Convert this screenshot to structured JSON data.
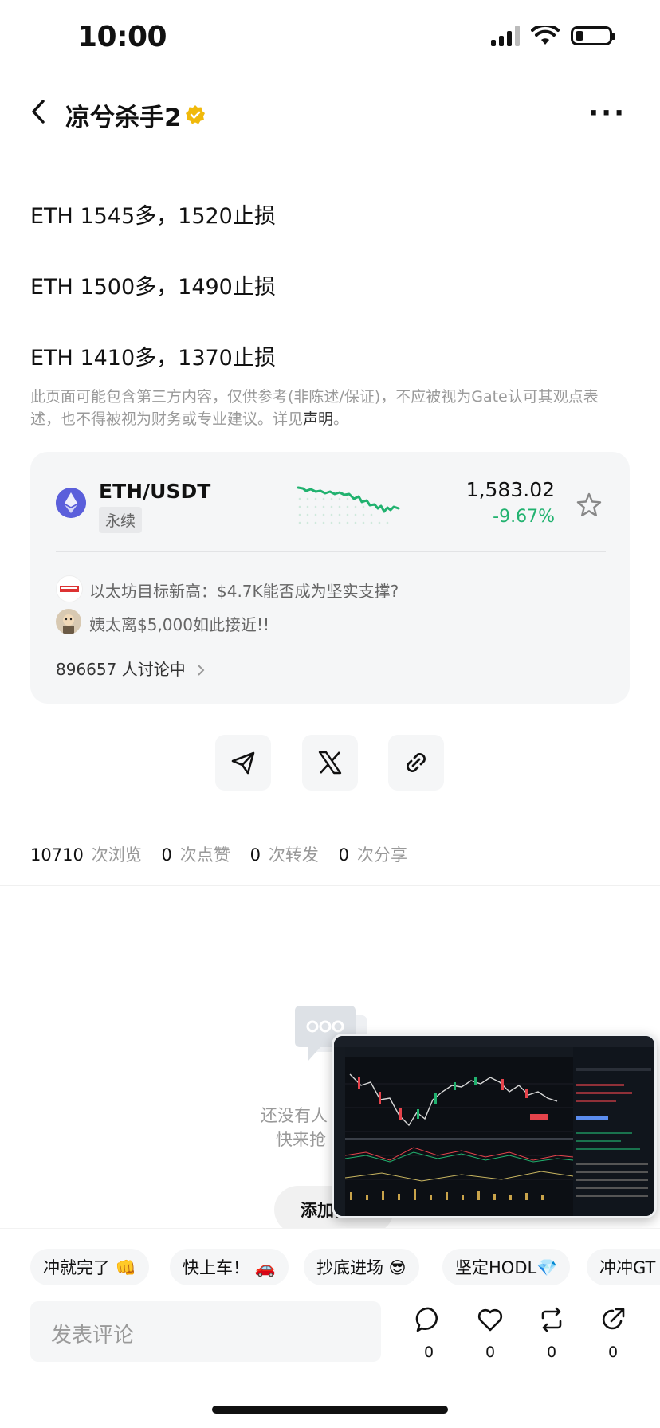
{
  "status_bar": {
    "time": "10:00"
  },
  "header": {
    "author": "凉兮杀手2"
  },
  "post": {
    "lines": [
      "ETH 1545多，1520止损",
      "ETH 1500多，1490止损",
      "ETH 1410多，1370止损"
    ],
    "disclaimer": "此页面可能包含第三方内容，仅供参考(非陈述/保证)，不应被视为Gate认可其观点表述，也不得被视为财务或专业建议。详见",
    "disclaimer_link": "声明",
    "disclaimer_end": "。"
  },
  "market_card": {
    "pair": "ETH/USDT",
    "contract": "永续",
    "price": "1,583.02",
    "change": "-9.67%",
    "change_color": "#21b26f",
    "news": [
      {
        "icon": "news-avatar-icon",
        "text": "以太坊目标新高：$4.7K能否成为坚实支撑?"
      },
      {
        "icon": "user-avatar-icon",
        "text": "姨太离$5,000如此接近!!"
      }
    ],
    "discussing_count": "896657",
    "discussing_label": "人讨论中"
  },
  "share": {
    "icons": [
      "send-icon",
      "x-icon",
      "link-icon"
    ]
  },
  "stats": [
    {
      "value": "10710",
      "label": "次浏览"
    },
    {
      "value": "0",
      "label": "次点赞"
    },
    {
      "value": "0",
      "label": "次转发"
    },
    {
      "value": "0",
      "label": "次分享"
    }
  ],
  "comments_empty": {
    "line1": "还没有人",
    "line2": "快来抢",
    "button": "添加首评"
  },
  "quick_replies": [
    "冲就完了 👊",
    "快上车！ 🚗",
    "抄底进场 😎",
    "坚定HODL💎",
    "冲冲GT"
  ],
  "comment_input": {
    "placeholder": "发表评论"
  },
  "actions": [
    {
      "icon": "comment-icon",
      "count": "0"
    },
    {
      "icon": "heart-icon",
      "count": "0"
    },
    {
      "icon": "repost-icon",
      "count": "0"
    },
    {
      "icon": "share-icon",
      "count": "0"
    }
  ]
}
